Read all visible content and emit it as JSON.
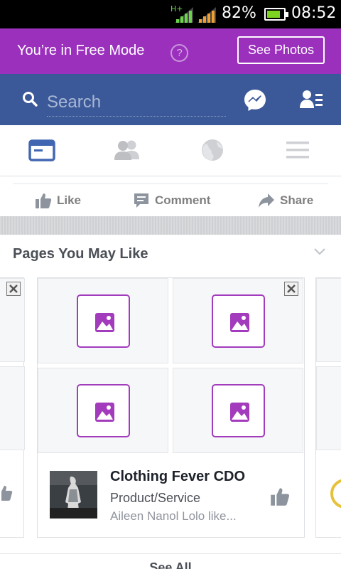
{
  "status_bar": {
    "network": "H+",
    "battery_percent": "82%",
    "battery_level": 0.82,
    "time": "08:52"
  },
  "free_mode": {
    "text": "You’re in Free Mode",
    "help_glyph": "?",
    "see_photos_label": "See Photos"
  },
  "search": {
    "placeholder": "Search"
  },
  "tabs": [
    {
      "icon": "news-feed-icon",
      "active": true
    },
    {
      "icon": "friends-icon",
      "active": false
    },
    {
      "icon": "globe-icon",
      "active": false
    },
    {
      "icon": "menu-icon",
      "active": false
    }
  ],
  "post_actions": {
    "like": "Like",
    "comment": "Comment",
    "share": "Share"
  },
  "pages_section": {
    "title": "Pages You May Like",
    "suggestion": {
      "name": "Clothing Fever CDO",
      "category": "Product/Service",
      "social_context": "Aileen Nanol Lolo like..."
    },
    "see_all": "See All"
  },
  "colors": {
    "free_mode_bg": "#9b30bd",
    "header_bg": "#3b5998",
    "placeholder_accent": "#a33bbd"
  }
}
